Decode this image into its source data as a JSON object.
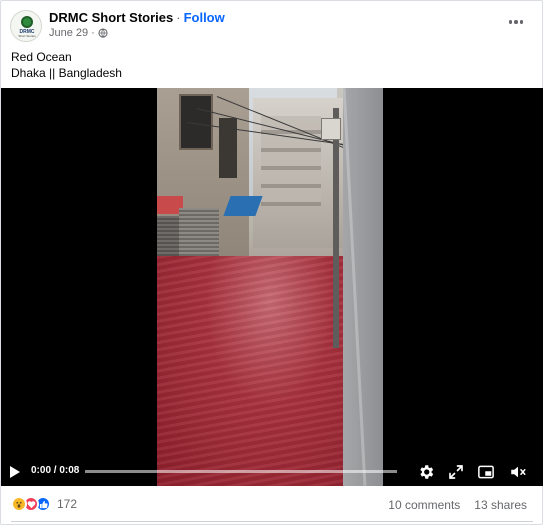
{
  "post": {
    "page_name": "DRMC Short Stories",
    "separator": "·",
    "follow_label": "Follow",
    "date": "June 29",
    "separator_2": "·",
    "audience_icon": "globe-icon",
    "avatar": {
      "line1": "DRMC",
      "line2": "Short Stories"
    },
    "caption_line1": "Red Ocean",
    "caption_line2": "Dhaka || Bangladesh"
  },
  "video": {
    "time": "0:00 / 0:08",
    "progress": 0,
    "icons": [
      "play-icon",
      "settings-icon",
      "fullscreen-icon",
      "picture-in-picture-icon",
      "volume-muted-icon"
    ]
  },
  "footer": {
    "reaction_icons": [
      "wow-icon",
      "love-icon",
      "like-icon"
    ],
    "reaction_count": "172",
    "comments": "10 comments",
    "shares": "13 shares"
  },
  "colors": {
    "accent": "#0866ff",
    "secondary_text": "#65676b",
    "love": "#f33e58",
    "wow": "#f7b928"
  }
}
